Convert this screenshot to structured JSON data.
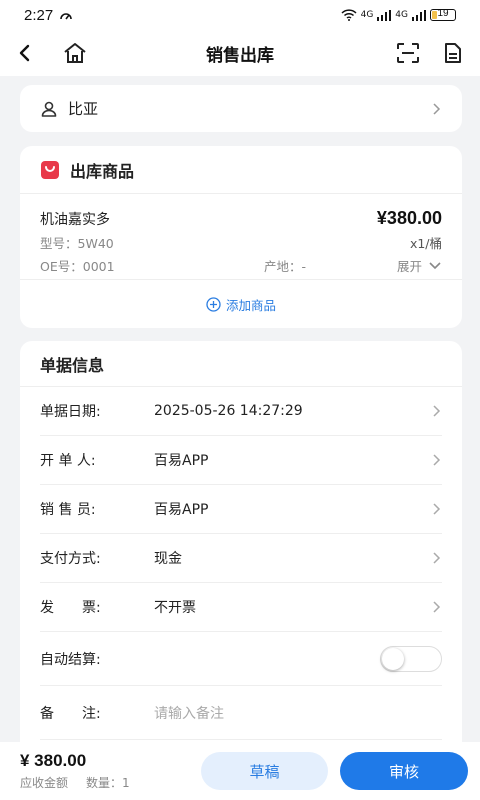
{
  "status_bar": {
    "time": "2:27",
    "network_label": "4G",
    "battery": "19",
    "battery_level": 0.19
  },
  "nav": {
    "title": "销售出库"
  },
  "customer": {
    "name": "比亚"
  },
  "goods_section": {
    "title": "出库商品",
    "items": [
      {
        "name": "机油嘉实多",
        "price": "¥380.00",
        "model": "型号：5W40",
        "qty": "x1/桶",
        "oe": "OE号：0001",
        "origin": "产地：-",
        "expand": "展开"
      }
    ],
    "add_label": "添加商品"
  },
  "info_section": {
    "title": "单据信息",
    "rows": [
      {
        "label": "单据日期:",
        "value": "2025-05-26 14:27:29"
      },
      {
        "label": "开 单 人:",
        "value": "百易APP"
      },
      {
        "label": "销 售 员:",
        "value": "百易APP"
      },
      {
        "label": "支付方式:",
        "value": "现金"
      },
      {
        "label": "发　　票:",
        "value": "不开票"
      },
      {
        "label": "自动结算:",
        "value": ""
      },
      {
        "label": "备　　注:",
        "placeholder": "请输入备注"
      }
    ],
    "auto_settle_on": false
  },
  "footer": {
    "total": "¥ 380.00",
    "total_label": "应收金额",
    "count": "数量：1",
    "draft_label": "草稿",
    "audit_label": "审核"
  },
  "colors": {
    "accent": "#1f7ae8",
    "accent_light": "#e4effd",
    "goods_icon": "#e8394a"
  },
  "icons": [
    "back-arrow-icon",
    "home-icon",
    "scan-icon",
    "document-icon",
    "user-icon",
    "shopping-bag-icon",
    "chevron-right-icon",
    "chevron-down-icon",
    "plus-circle-icon"
  ]
}
